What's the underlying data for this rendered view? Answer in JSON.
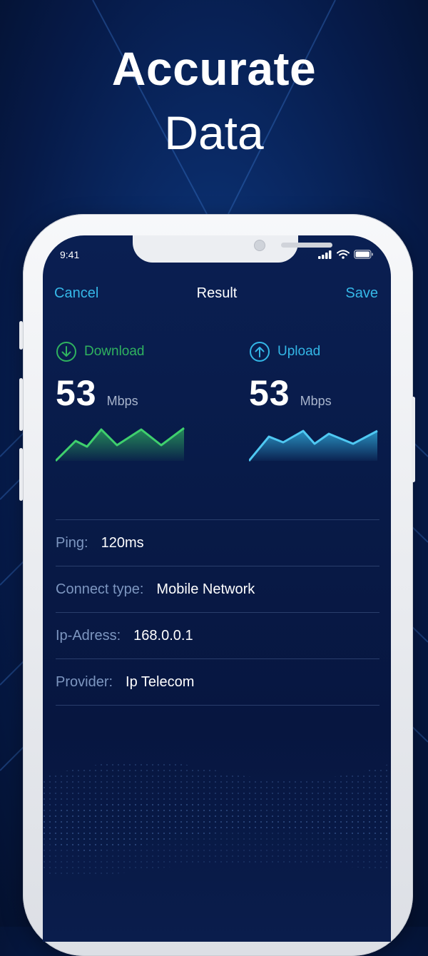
{
  "headline": {
    "line1": "Accurate",
    "line2": "Data"
  },
  "status_bar": {
    "time": "9:41"
  },
  "nav": {
    "cancel": "Cancel",
    "title": "Result",
    "save": "Save"
  },
  "download": {
    "label": "Download",
    "value": "53",
    "unit": "Mbps",
    "color": "#2fb25f"
  },
  "upload": {
    "label": "Upload",
    "value": "53",
    "unit": "Mbps",
    "color": "#33b6e6"
  },
  "info": {
    "ping": {
      "label": "Ping:",
      "value": "120ms"
    },
    "connect_type": {
      "label": "Connect type:",
      "value": "Mobile Network"
    },
    "ip_address": {
      "label": "Ip-Adress:",
      "value": "168.0.0.1"
    },
    "provider": {
      "label": "Provider:",
      "value": "Ip Telecom"
    }
  },
  "colors": {
    "accent": "#36b8e8",
    "background": "#061a48"
  }
}
